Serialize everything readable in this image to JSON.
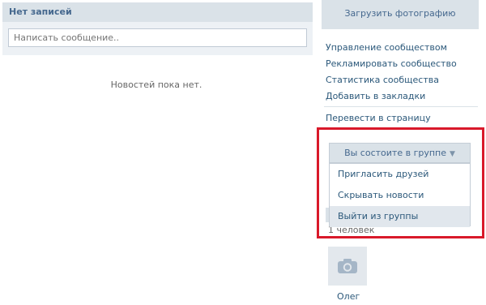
{
  "wall": {
    "title": "Нет записей",
    "input_placeholder": "Написать сообщение..",
    "empty_text": "Новостей пока нет."
  },
  "sidebar": {
    "upload_photo": "Загрузить фотографию",
    "links": [
      "Управление сообществом",
      "Рекламировать сообщество",
      "Статистика сообщества",
      "Добавить в закладки"
    ],
    "convert_link": "Перевести в страницу"
  },
  "membership": {
    "button_label": "Вы состоите в группе",
    "menu_items": [
      "Пригласить друзей",
      "Скрывать новости",
      "Выйти из группы"
    ]
  },
  "members": {
    "count_text": "1 человек",
    "member_name": "Олег"
  },
  "colors": {
    "accent": "#45688e",
    "link": "#2b587a",
    "highlight_frame": "#d9192a",
    "header_bg": "#dae2e8"
  },
  "icons": {
    "avatar": "camera-icon",
    "dropdown": "chevron-down-icon"
  }
}
